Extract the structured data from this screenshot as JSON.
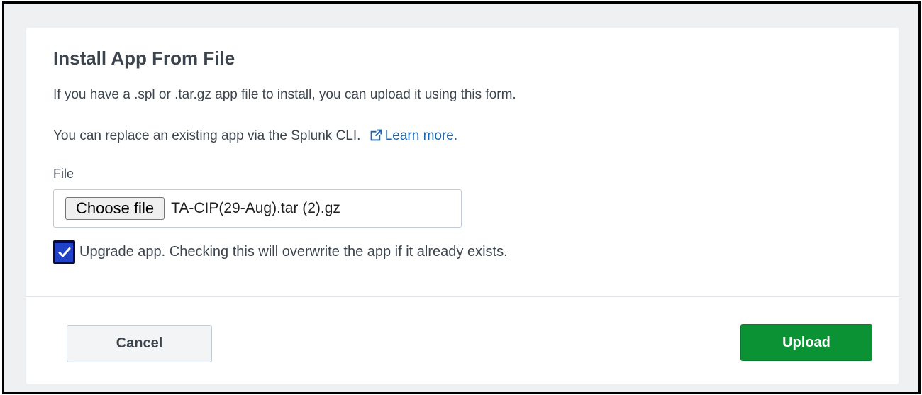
{
  "dialog": {
    "title": "Install App From File",
    "intro": "If you have a .spl or .tar.gz app file to install, you can upload it using this form.",
    "cli_text": "You can replace an existing app via the Splunk CLI.",
    "learn_more": "Learn more.",
    "learn_more_icon": "external-link-icon"
  },
  "file": {
    "label": "File",
    "choose_button": "Choose file",
    "selected_file": "TA-CIP(29-Aug).tar (2).gz"
  },
  "upgrade": {
    "checked": true,
    "label": "Upgrade app. Checking this will overwrite the app if it already exists."
  },
  "footer": {
    "cancel": "Cancel",
    "upload": "Upload"
  },
  "colors": {
    "link": "#1a66b2",
    "primary": "#0a9235",
    "checkbox": "#2042c6",
    "text": "#3c444d"
  }
}
